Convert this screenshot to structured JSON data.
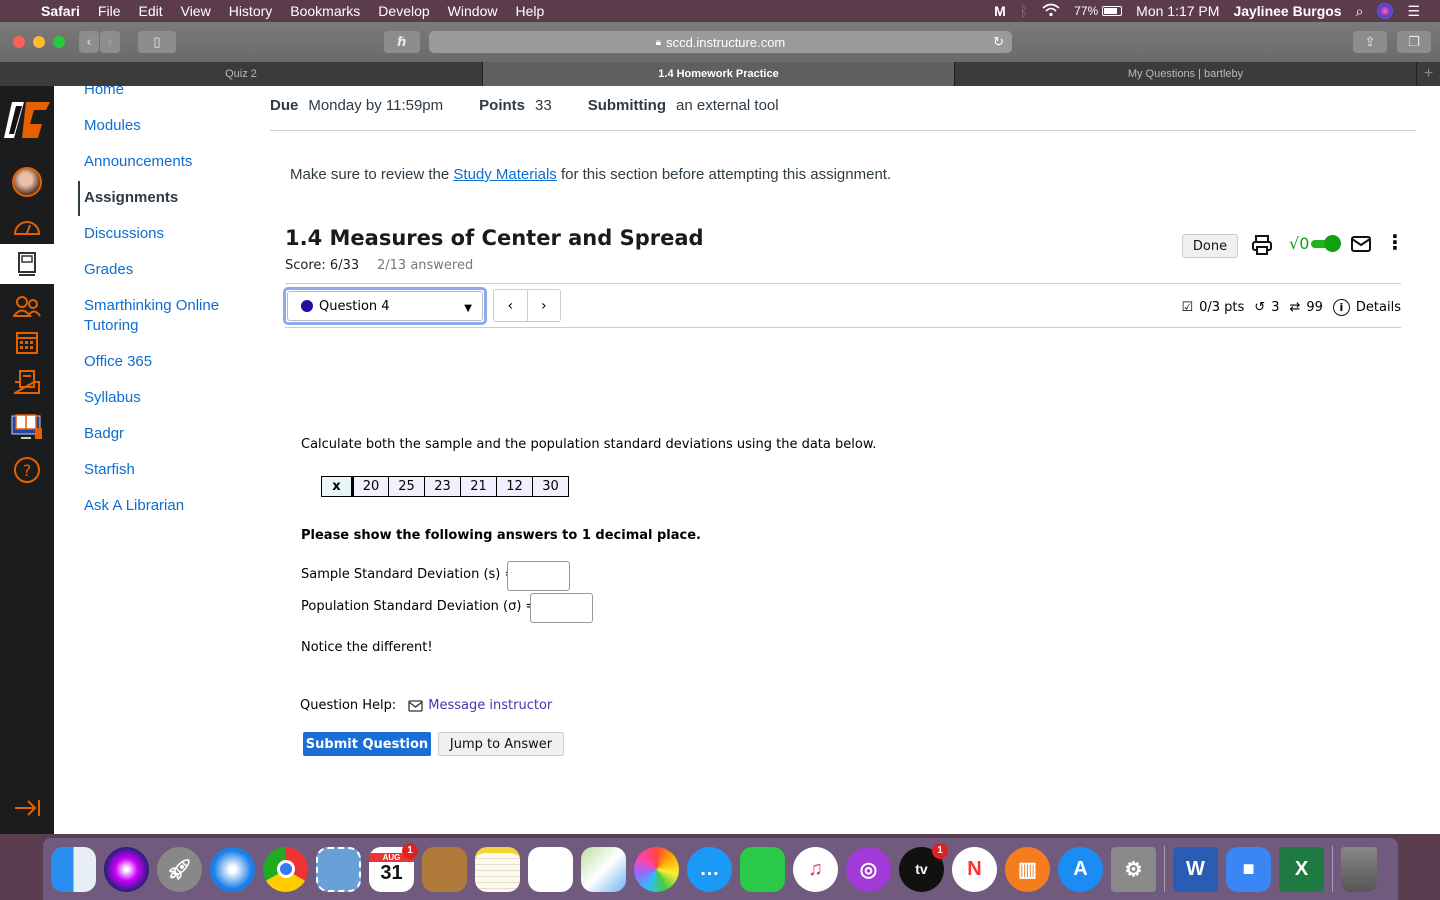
{
  "menubar": {
    "app": "Safari",
    "items": [
      "File",
      "Edit",
      "View",
      "History",
      "Bookmarks",
      "Develop",
      "Window",
      "Help"
    ],
    "battery": "77%",
    "clock": "Mon 1:17 PM",
    "user": "Jaylinee Burgos"
  },
  "browser": {
    "url": "sccd.instructure.com",
    "tabs": [
      {
        "label": "Quiz 2",
        "active": false
      },
      {
        "label": "1.4 Homework Practice",
        "active": true
      },
      {
        "label": "My Questions | bartleby",
        "active": false
      }
    ]
  },
  "course_nav": {
    "items": [
      {
        "label": "Home"
      },
      {
        "label": "Modules"
      },
      {
        "label": "Announcements"
      },
      {
        "label": "Assignments",
        "active": true
      },
      {
        "label": "Discussions"
      },
      {
        "label": "Grades"
      },
      {
        "label": "Smarthinking Online Tutoring"
      },
      {
        "label": "Office 365"
      },
      {
        "label": "Syllabus"
      },
      {
        "label": "Badgr"
      },
      {
        "label": "Starfish"
      },
      {
        "label": "Ask A Librarian"
      }
    ]
  },
  "assignment": {
    "due_label": "Due",
    "due_value": "Monday by 11:59pm",
    "points_label": "Points",
    "points_value": "33",
    "submitting_label": "Submitting",
    "submitting_value": "an external tool",
    "notice_pre": "Make sure to review the ",
    "notice_link": "Study Materials",
    "notice_post": " for this section before attempting this assignment."
  },
  "quiz": {
    "title": "1.4 Measures of Center and Spread",
    "score": "Score: 6/33",
    "answered": "2/13 answered",
    "done_label": "Done",
    "question_select": "Question 4",
    "points": "0/3 pts",
    "retries": "3",
    "attempts": "99",
    "details_label": "Details",
    "prompt": "Calculate both the sample and the population standard deviations using the data below.",
    "table_header": "x",
    "table_values": [
      "20",
      "25",
      "23",
      "21",
      "12",
      "30"
    ],
    "instruction": "Please show the following answers to 1 decimal place.",
    "sample_label": "Sample Standard Deviation (s) =",
    "population_label": "Population Standard Deviation (σ) =",
    "sample_value": "",
    "population_value": "",
    "note": "Notice the different!",
    "help_label": "Question Help:",
    "help_link": "Message instructor",
    "submit_label": "Submit Question",
    "jump_label": "Jump to Answer"
  },
  "dock": {
    "calendar_month": "AUG",
    "calendar_day": "31",
    "calendar_badge": "1",
    "tv_badge": "1"
  }
}
